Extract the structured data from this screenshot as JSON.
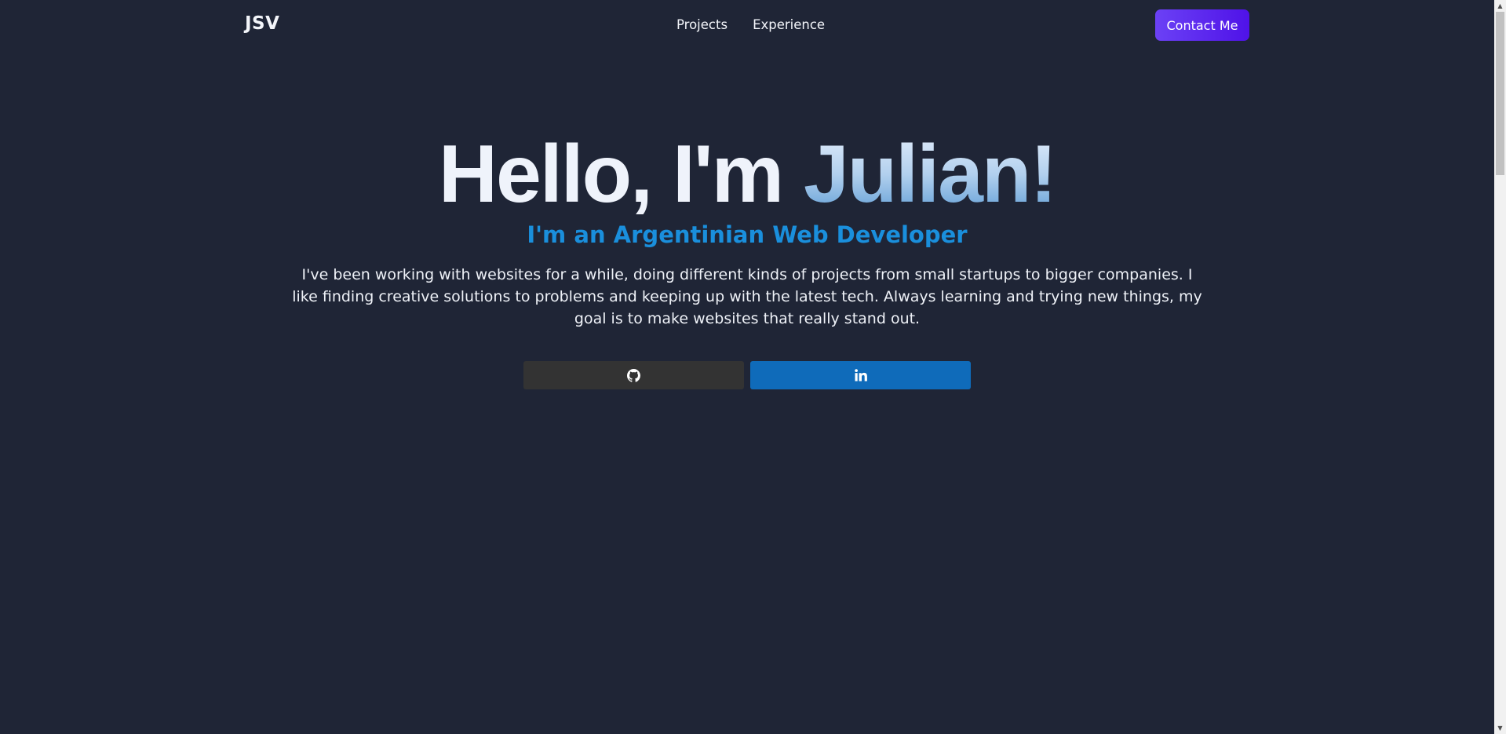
{
  "nav": {
    "brand": "JSV",
    "links": [
      {
        "label": "Projects"
      },
      {
        "label": "Experience"
      }
    ],
    "contact_label": "Contact Me"
  },
  "hero": {
    "title_prefix": "Hello, I'm ",
    "title_name": "Julian!",
    "subtitle": "I'm an Argentinian Web Developer",
    "description": "I've been working with websites for a while, doing different kinds of projects from small startups to bigger companies. I like finding creative solutions to problems and keeping up with the latest tech. Always learning and trying new things, my goal is to make websites that really stand out."
  },
  "social": {
    "github_icon": "github-icon",
    "linkedin_icon": "linkedin-icon"
  },
  "colors": {
    "background": "#1f2536",
    "accent": "#1a8fdc",
    "contact_button": "#5a2bf0",
    "github_button": "#333333",
    "linkedin_button": "#0f6bba"
  }
}
